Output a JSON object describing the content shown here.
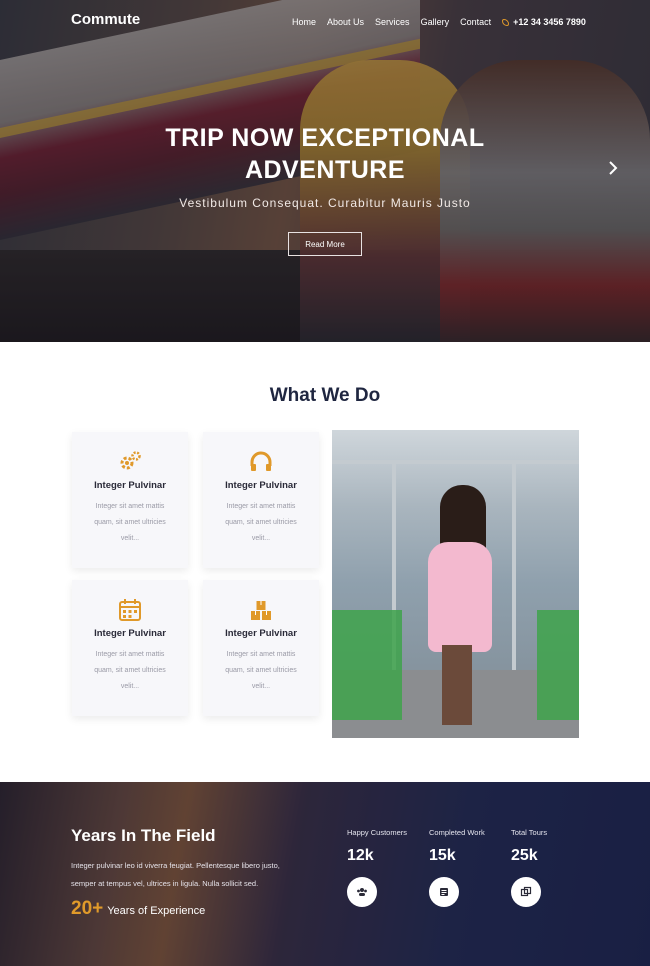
{
  "nav": {
    "brand": "Commute",
    "items": [
      "Home",
      "About Us",
      "Services",
      "Gallery",
      "Contact"
    ],
    "phone": "+12 34 3456 7890"
  },
  "hero": {
    "title_line1": "TRIP NOW EXCEPTIONAL",
    "title_line2": "ADVENTURE",
    "subtitle": "Vestibulum Consequat. Curabitur Mauris Justo",
    "button": "Read More"
  },
  "what_we_do": {
    "title": "What We Do",
    "cards": [
      {
        "icon": "gears-icon",
        "title": "Integer Pulvinar",
        "l1": "Integer sit amet mattis",
        "l2": "quam, sit amet ultricies",
        "l3": "velit..."
      },
      {
        "icon": "headphones-icon",
        "title": "Integer Pulvinar",
        "l1": "Integer sit amet mattis",
        "l2": "quam, sit amet ultricies",
        "l3": "velit..."
      },
      {
        "icon": "calendar-icon",
        "title": "Integer Pulvinar",
        "l1": "Integer sit amet mattis",
        "l2": "quam, sit amet ultricies",
        "l3": "velit..."
      },
      {
        "icon": "boxes-icon",
        "title": "Integer Pulvinar",
        "l1": "Integer sit amet mattis",
        "l2": "quam, sit amet ultricies",
        "l3": "velit..."
      }
    ]
  },
  "stats": {
    "title": "Years In The Field",
    "desc_l1": "Integer pulvinar leo id viverra feugiat. Pellentesque libero justo,",
    "desc_l2": "semper at tempus vel, ultrices in ligula. Nulla sollicit sed.",
    "years_num": "20+",
    "years_label": "Years of Experience",
    "items": [
      {
        "label": "Happy Customers",
        "value": "12k",
        "icon": "users-icon"
      },
      {
        "label": "Completed Work",
        "value": "15k",
        "icon": "list-icon"
      },
      {
        "label": "Total Tours",
        "value": "25k",
        "icon": "layers-icon"
      }
    ]
  },
  "colors": {
    "accent": "#e09a2a",
    "dark": "#1f2640"
  }
}
